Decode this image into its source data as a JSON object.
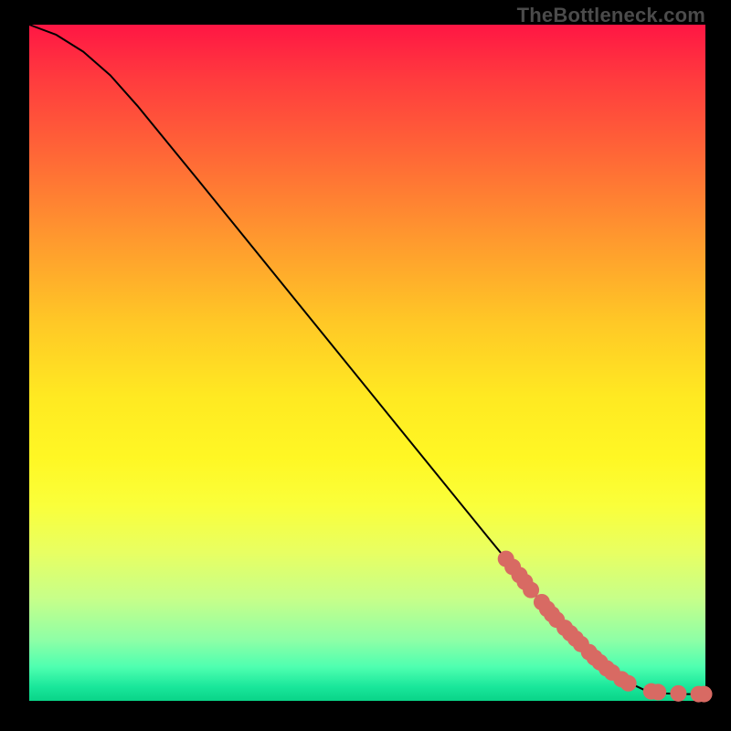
{
  "watermark": "TheBottleneck.com",
  "chart_data": {
    "type": "line",
    "title": "",
    "xlabel": "",
    "ylabel": "",
    "xlim": [
      0,
      100
    ],
    "ylim": [
      0,
      100
    ],
    "curve": [
      {
        "x": 0,
        "y": 100
      },
      {
        "x": 4,
        "y": 98.5
      },
      {
        "x": 8,
        "y": 96
      },
      {
        "x": 12,
        "y": 92.5
      },
      {
        "x": 16,
        "y": 88
      },
      {
        "x": 25,
        "y": 77
      },
      {
        "x": 40,
        "y": 58.5
      },
      {
        "x": 55,
        "y": 40
      },
      {
        "x": 68,
        "y": 24
      },
      {
        "x": 75,
        "y": 15.5
      },
      {
        "x": 80,
        "y": 10
      },
      {
        "x": 84,
        "y": 6
      },
      {
        "x": 88,
        "y": 3
      },
      {
        "x": 91,
        "y": 1.6
      },
      {
        "x": 94,
        "y": 1.1
      },
      {
        "x": 97,
        "y": 1
      },
      {
        "x": 100,
        "y": 1
      }
    ],
    "markers": [
      {
        "x": 70.5,
        "y": 21
      },
      {
        "x": 71.5,
        "y": 19.8
      },
      {
        "x": 72.5,
        "y": 18.6
      },
      {
        "x": 73.3,
        "y": 17.6
      },
      {
        "x": 74.2,
        "y": 16.4
      },
      {
        "x": 75.8,
        "y": 14.6
      },
      {
        "x": 76.6,
        "y": 13.6
      },
      {
        "x": 77.3,
        "y": 12.8
      },
      {
        "x": 78,
        "y": 12
      },
      {
        "x": 79.2,
        "y": 10.8
      },
      {
        "x": 80,
        "y": 10
      },
      {
        "x": 80.8,
        "y": 9.2
      },
      {
        "x": 81.6,
        "y": 8.4
      },
      {
        "x": 82.8,
        "y": 7.2
      },
      {
        "x": 83.6,
        "y": 6.4
      },
      {
        "x": 84.4,
        "y": 5.7
      },
      {
        "x": 85.4,
        "y": 4.8
      },
      {
        "x": 86.2,
        "y": 4.2
      },
      {
        "x": 87.6,
        "y": 3.2
      },
      {
        "x": 88.6,
        "y": 2.6
      },
      {
        "x": 92,
        "y": 1.4
      },
      {
        "x": 93,
        "y": 1.3
      },
      {
        "x": 96,
        "y": 1.1
      },
      {
        "x": 99,
        "y": 1.0
      },
      {
        "x": 99.8,
        "y": 1.0
      }
    ],
    "marker_color": "#d86a63",
    "background_gradient": [
      "#ff1644",
      "#ffe922",
      "#0ad488"
    ]
  }
}
